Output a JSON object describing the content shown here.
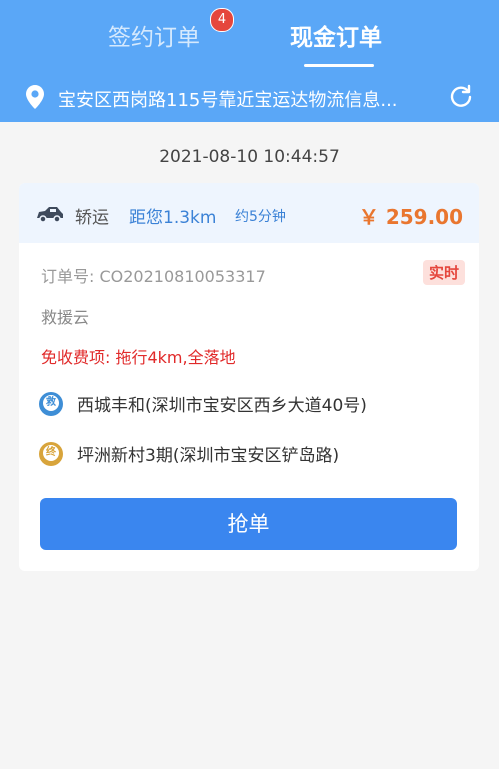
{
  "tabs": {
    "sign_label": "签约订单",
    "sign_badge": "4",
    "cash_label": "现金订单"
  },
  "location": {
    "text": "宝安区西岗路115号靠近宝运达物流信息..."
  },
  "timestamp": "2021-08-10 10:44:57",
  "order": {
    "service": "轿运",
    "distance": "距您1.3km",
    "eta": "约5分钟",
    "price": "￥ 259.00",
    "order_no": "订单号: CO20210810053317",
    "tag": "实时",
    "company": "救援云",
    "free_items": "免收费项: 拖行4km,全落地",
    "start_marker": "救",
    "start_address": "西城丰和(深圳市宝安区西乡大道40号)",
    "end_marker": "终",
    "end_address": "坪洲新村3期(深圳市宝安区铲岛路)",
    "grab_label": "抢单"
  },
  "colors": {
    "header": "#5aa7f7",
    "price": "#e9762f",
    "button": "#3a86ef",
    "alert": "#e12a2a"
  }
}
